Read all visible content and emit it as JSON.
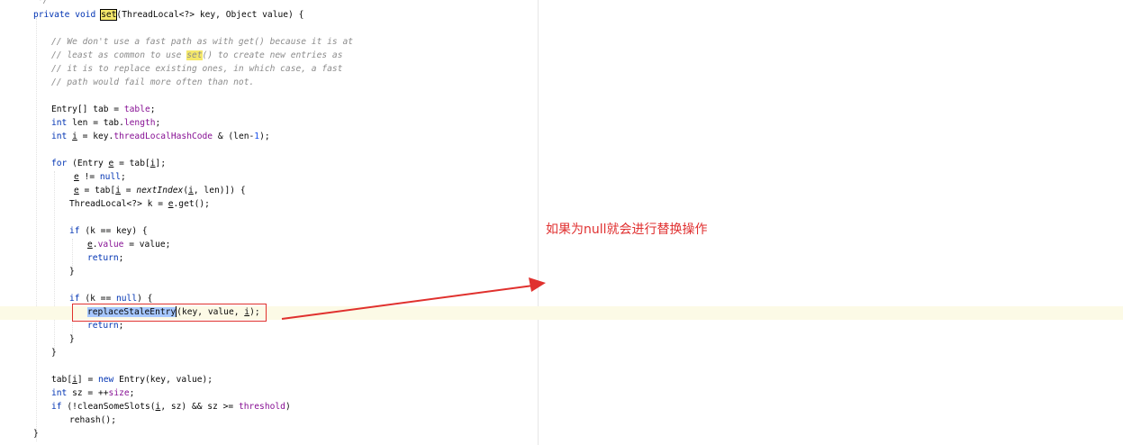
{
  "code": {
    "top_comment_end": "*/",
    "sig": {
      "mod": "private void ",
      "name": "set",
      "rest": "(ThreadLocal<?> key, Object value) {"
    },
    "c1": "// We don't use a fast path as with get() because it is at",
    "c2a": "// least as common to use ",
    "c2b": "set",
    "c2c": "() to create new entries as",
    "c3": "// it is to replace existing ones, in which case, a fast",
    "c4": "// path would fail more often than not.",
    "l_tab_a": "Entry[] tab = ",
    "l_tab_b": "table",
    "l_tab_c": ";",
    "l_len_kw": "int",
    "l_len_a": " len = tab.",
    "l_len_b": "length",
    "l_len_c": ";",
    "l_i_kw": "int",
    "l_i_a": " ",
    "l_i_var": "i",
    "l_i_b": " = key.",
    "l_i_f": "threadLocalHashCode",
    "l_i_c": " & (len-",
    "l_i_n": "1",
    "l_i_d": ");",
    "for_kw": "for",
    "for_a": " (Entry ",
    "for_e": "e",
    "for_b": " = tab[",
    "for_i": "i",
    "for_c": "];",
    "cond_e": "e",
    "cond_a": " != ",
    "cond_null": "null",
    "cond_b": ";",
    "inc_e": "e",
    "inc_a": " = tab[",
    "inc_i": "i",
    "inc_b": " = ",
    "inc_fn": "nextIndex",
    "inc_c": "(",
    "inc_i2": "i",
    "inc_d": ", len)]) {",
    "tl_a": "ThreadLocal<?> k = ",
    "tl_e": "e",
    "tl_b": ".get();",
    "if1_kw": "if",
    "if1_a": " (k == key) {",
    "ev_e": "e",
    "ev_a": ".",
    "ev_f": "value",
    "ev_b": " = value;",
    "ret1": "return",
    "ret1_s": ";",
    "close1": "}",
    "if2_kw": "if",
    "if2_a": " (k == ",
    "if2_null": "null",
    "if2_b": ") {",
    "rse_name": "replaceStaleEntry",
    "rse_a": "(key, value, ",
    "rse_i": "i",
    "rse_b": ");",
    "ret2": "return",
    "ret2_s": ";",
    "close2": "}",
    "close3": "}",
    "ti_a": "tab[",
    "ti_i": "i",
    "ti_b": "] = ",
    "ti_new": "new",
    "ti_c": " Entry(key, value);",
    "sz_kw": "int",
    "sz_a": " sz = ++",
    "sz_f": "size",
    "sz_b": ";",
    "cs_kw": "if",
    "cs_a": " (!cleanSomeSlots(",
    "cs_i": "i",
    "cs_b": ", sz) && sz >= ",
    "cs_f": "threshold",
    "cs_c": ")",
    "rehash": "rehash();",
    "close4": "}"
  },
  "annotation": {
    "text": "如果为null就会进行替换操作",
    "color": "#e03030"
  },
  "colors": {
    "keyword": "#0033b3",
    "field": "#871094",
    "number": "#1750eb",
    "comment": "#8c8c8c",
    "search_highlight": "#f5e86a",
    "selection": "#a6c7ff",
    "box": "#e0312e"
  }
}
